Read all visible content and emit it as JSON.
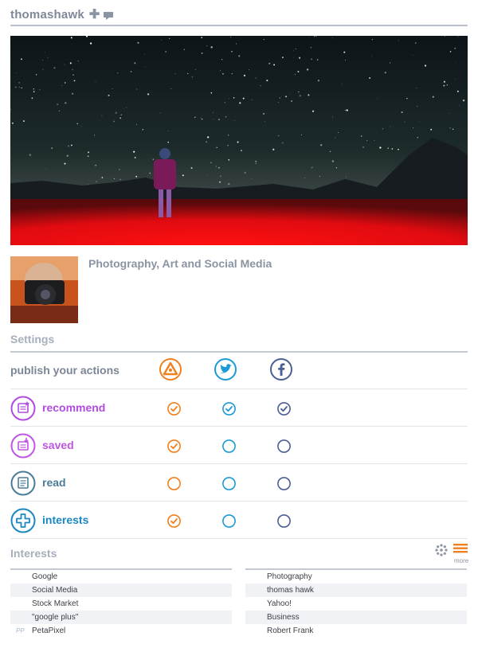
{
  "header": {
    "username": "thomashawk",
    "follow_glyph": "✚",
    "message_icon": "speech-bubble-icon"
  },
  "banner": {
    "icon": "night-sky-portrait-photo"
  },
  "profile": {
    "tagline": "Photography, Art and Social Media",
    "avatar_icon": "photographer-avatar"
  },
  "settings": {
    "title": "Settings",
    "publish_label": "publish your actions",
    "services": [
      {
        "name": "app",
        "icon": "triangle-logo-icon",
        "color": "#f0801e"
      },
      {
        "name": "twitter",
        "icon": "twitter-bird-icon",
        "color": "#1c9ad6"
      },
      {
        "name": "facebook",
        "icon": "facebook-f-icon",
        "color": "#4b5f95"
      }
    ],
    "rows": [
      {
        "label": "recommend",
        "color": "#b24be0",
        "icon": "recommend-card-icon",
        "checks": [
          true,
          true,
          true
        ]
      },
      {
        "label": "saved",
        "color": "#c055e0",
        "icon": "saved-card-icon",
        "checks": [
          true,
          false,
          false
        ]
      },
      {
        "label": "read",
        "color": "#4a7c99",
        "icon": "read-card-icon",
        "checks": [
          false,
          false,
          false
        ]
      },
      {
        "label": "interests",
        "color": "#1a87c3",
        "icon": "plus-circle-icon",
        "checks": [
          true,
          false,
          false
        ]
      }
    ]
  },
  "interests": {
    "title": "Interests",
    "more_label": "more",
    "view_icons": [
      "cloud-view-icon",
      "list-view-icon"
    ],
    "left": [
      {
        "text": "Google",
        "source": ""
      },
      {
        "text": "Social Media",
        "source": ""
      },
      {
        "text": "Stock Market",
        "source": ""
      },
      {
        "text": "\"google plus\"",
        "source": ""
      },
      {
        "text": "PetaPixel",
        "source": "PP"
      }
    ],
    "right": [
      {
        "text": "Photography",
        "source": ""
      },
      {
        "text": "thomas hawk",
        "source": ""
      },
      {
        "text": "Yahoo!",
        "source": ""
      },
      {
        "text": "Business",
        "source": ""
      },
      {
        "text": "Robert Frank",
        "source": ""
      }
    ]
  },
  "colors": {
    "orange": "#f0801e",
    "twitter": "#1c9ad6",
    "facebook": "#4b5f95",
    "rule": "#c3c9d2"
  }
}
